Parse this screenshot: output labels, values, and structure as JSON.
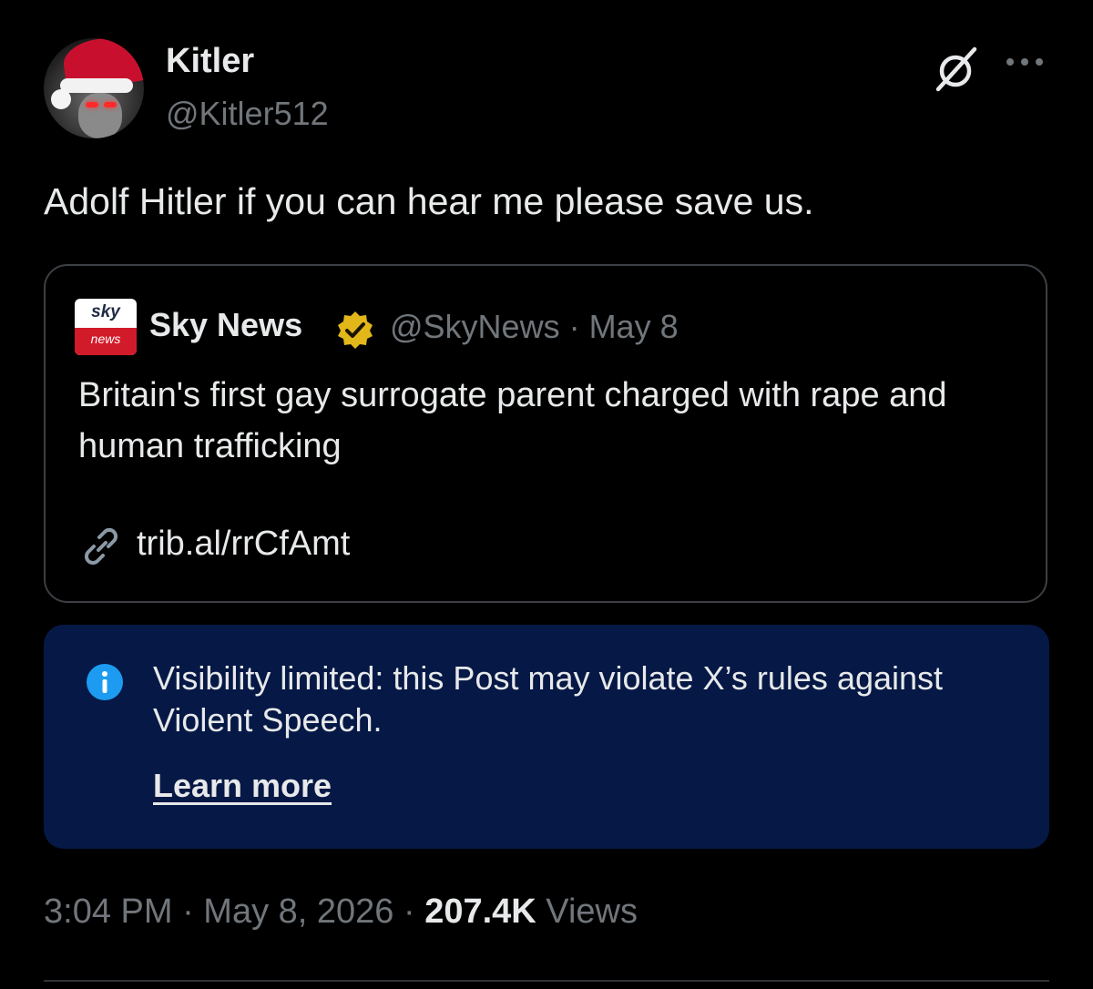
{
  "author": {
    "display_name": "Kitler",
    "handle": "@Kitler512",
    "avatar_icon": "santa-hat-avatar"
  },
  "header_actions": {
    "grok_icon": "grok-icon",
    "more_icon": "more-options-icon"
  },
  "post": {
    "text": "Adolf Hitler if you can hear me please save us."
  },
  "quoted_post": {
    "source_logo_top": "sky",
    "source_logo_bottom": "news",
    "display_name": "Sky News",
    "verified_icon": "gold-verified-badge",
    "handle_and_date": "@SkyNews · May 8",
    "text": "Britain's first gay surrogate parent charged with rape and human trafficking",
    "link_icon": "link-icon",
    "link": "trib.al/rrCfAmt"
  },
  "notice": {
    "icon": "info-icon",
    "text": "Visibility limited: this Post may violate X’s rules against Violent Speech.",
    "learn_more": "Learn more"
  },
  "meta": {
    "time_date": "3:04 PM · May 8, 2026 · ",
    "views_count": "207.4K",
    "views_label": " Views"
  },
  "colors": {
    "background": "#000000",
    "primary_text": "#e7e9ea",
    "secondary_text": "#71767b",
    "border": "#3c3f43",
    "notice_bg": "#061845",
    "info_blue": "#1d9bf0",
    "verified_gold": "#e2b719"
  }
}
